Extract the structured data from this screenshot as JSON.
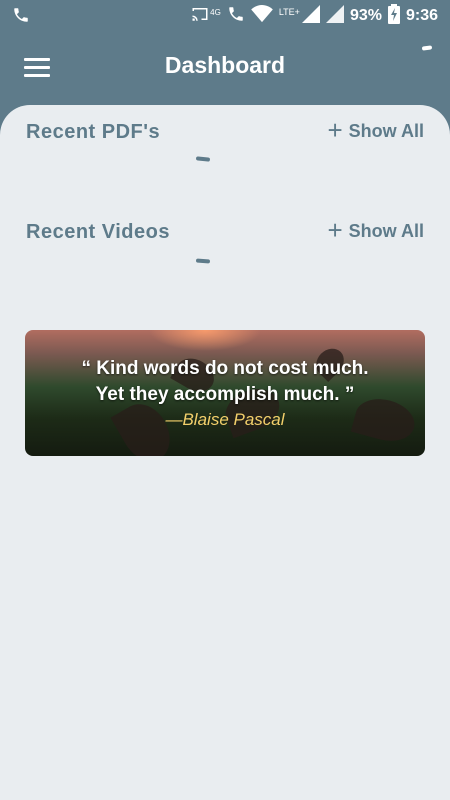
{
  "status_bar": {
    "battery": "93%",
    "time": "9:36",
    "network_label": "LTE+",
    "network_4g": "4G",
    "icons": [
      "phone-icon",
      "cast-icon",
      "volte-call-icon",
      "wifi-icon",
      "signal-icon",
      "signal-icon",
      "battery-charging-icon"
    ]
  },
  "app_bar": {
    "title": "Dashboard",
    "menu_icon": "hamburger-menu-icon"
  },
  "sections": {
    "pdfs": {
      "title": "Recent PDF's",
      "show_all": "Show All"
    },
    "videos": {
      "title": "Recent Videos",
      "show_all": "Show All"
    }
  },
  "quote": {
    "line1": "“ Kind words do not cost much.",
    "line2": "Yet they accomplish much.  ”",
    "author": "—Blaise Pascal"
  },
  "colors": {
    "app_bar": "#5e7b8a",
    "content_bg": "#e9edf0",
    "accent_text": "#5e7b8a",
    "author_text": "#f2cf6b"
  }
}
